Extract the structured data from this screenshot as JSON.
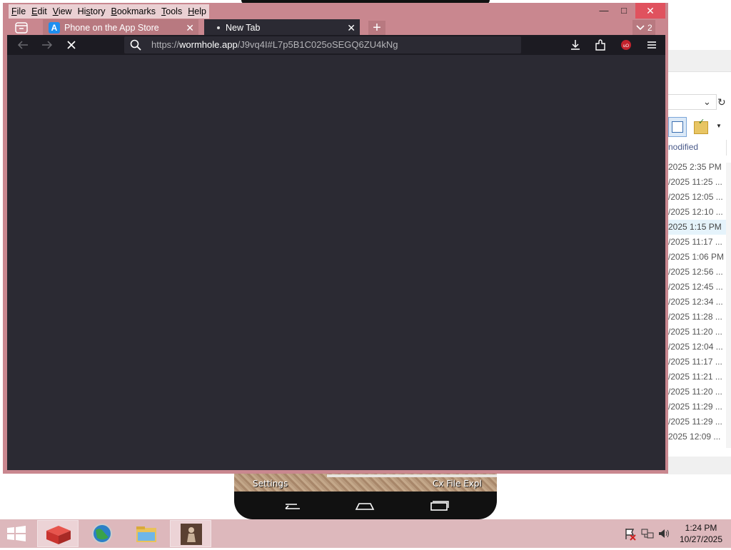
{
  "browser": {
    "menu": [
      "File",
      "Edit",
      "View",
      "History",
      "Bookmarks",
      "Tools",
      "Help"
    ],
    "menu_access_keys": [
      "F",
      "E",
      "V",
      "s",
      "B",
      "T",
      "H"
    ],
    "tabs": [
      {
        "title": "Phone on the App Store",
        "favicon": "app-store-icon",
        "active": false
      },
      {
        "title": "New Tab",
        "favicon": "loading-dot-icon",
        "active": true
      }
    ],
    "tab_count": "2",
    "url_prefix": "https://",
    "url_host": "wormhole.app",
    "url_path": "/J9vq4I#L7p5B1C025oSEGQ6ZU4kNg",
    "theme_colors": {
      "frame": "#c9878f",
      "toolbar": "#1c1b22",
      "content": "#2b2a33",
      "close": "#e0525e"
    }
  },
  "explorer": {
    "column_header": "nodified",
    "rows": [
      {
        "modified": "2025 2:35 PM",
        "selected": false
      },
      {
        "modified": "/2025 11:25 ...",
        "selected": false
      },
      {
        "modified": "/2025 12:05 ...",
        "selected": false
      },
      {
        "modified": "/2025 12:10 ...",
        "selected": false
      },
      {
        "modified": "2025 1:15 PM",
        "selected": true
      },
      {
        "modified": "/2025 11:17 ...",
        "selected": false
      },
      {
        "modified": "/2025 1:06 PM",
        "selected": false
      },
      {
        "modified": "/2025 12:56 ...",
        "selected": false
      },
      {
        "modified": "/2025 12:45 ...",
        "selected": false
      },
      {
        "modified": "/2025 12:34 ...",
        "selected": false
      },
      {
        "modified": "/2025 11:28 ...",
        "selected": false
      },
      {
        "modified": "/2025 11:20 ...",
        "selected": false
      },
      {
        "modified": "/2025 12:04 ...",
        "selected": false
      },
      {
        "modified": "/2025 11:17 ...",
        "selected": false
      },
      {
        "modified": "/2025 11:21 ...",
        "selected": false
      },
      {
        "modified": "/2025 11:20 ...",
        "selected": false
      },
      {
        "modified": "/2025 11:29 ...",
        "selected": false
      },
      {
        "modified": "/2025 11:29 ...",
        "selected": false
      },
      {
        "modified": "2025 12:09 ...",
        "selected": false
      }
    ]
  },
  "phone": {
    "left_label": "Settings",
    "right_label": "Cx File Expl"
  },
  "taskbar": {
    "apps": [
      "box-app-icon",
      "browser-globe-icon",
      "file-explorer-icon",
      "photo-app-icon"
    ],
    "time": "1:24 PM",
    "date": "10/27/2025"
  }
}
